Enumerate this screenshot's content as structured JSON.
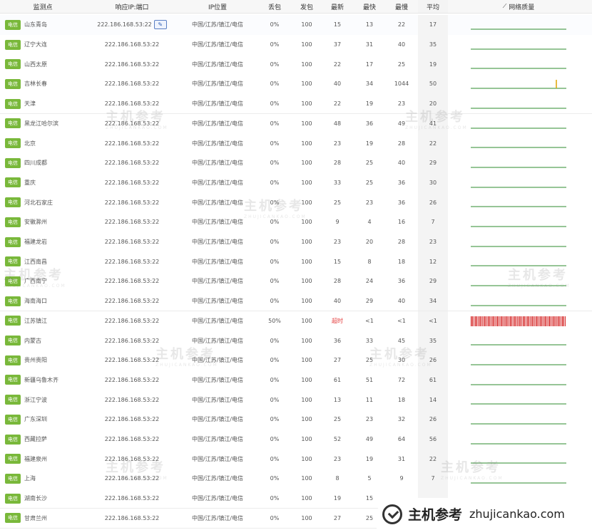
{
  "headers": {
    "node": "监测点",
    "ip_port": "响应IP:端口",
    "location": "IP位置",
    "loss": "丢包",
    "sent": "发包",
    "latest": "最新",
    "fastest": "最快",
    "slowest": "最慢",
    "average": "平均",
    "quality": "网络质量",
    "quality_icon": "signal-icon"
  },
  "badge_label": "电信",
  "edit_icon": "wrench-icon",
  "rows": [
    {
      "node": "山东青岛",
      "ip": "222.186.168.53:22",
      "loc": "中国/江苏/镇江/电信",
      "loss": "0%",
      "sent": "100",
      "latest": "15",
      "fastest": "13",
      "slowest": "22",
      "avg": "17",
      "status": "ok"
    },
    {
      "node": "辽宁大连",
      "ip": "222.186.168.53:22",
      "loc": "中国/江苏/镇江/电信",
      "loss": "0%",
      "sent": "100",
      "latest": "37",
      "fastest": "31",
      "slowest": "40",
      "avg": "35",
      "status": "ok"
    },
    {
      "node": "山西太原",
      "ip": "222.186.168.53:22",
      "loc": "中国/江苏/镇江/电信",
      "loss": "0%",
      "sent": "100",
      "latest": "22",
      "fastest": "17",
      "slowest": "25",
      "avg": "19",
      "status": "ok"
    },
    {
      "node": "吉林长春",
      "ip": "222.186.168.53:22",
      "loc": "中国/江苏/镇江/电信",
      "loss": "0%",
      "sent": "100",
      "latest": "40",
      "fastest": "34",
      "slowest": "1044",
      "avg": "50",
      "status": "spike"
    },
    {
      "node": "天津",
      "ip": "222.186.168.53:22",
      "loc": "中国/江苏/镇江/电信",
      "loss": "0%",
      "sent": "100",
      "latest": "22",
      "fastest": "19",
      "slowest": "23",
      "avg": "20",
      "status": "ok"
    },
    {
      "node": "黑龙江哈尔滨",
      "ip": "222.186.168.53:22",
      "loc": "中国/江苏/镇江/电信",
      "loss": "0%",
      "sent": "100",
      "latest": "48",
      "fastest": "36",
      "slowest": "49",
      "avg": "41",
      "status": "ok"
    },
    {
      "node": "北京",
      "ip": "222.186.168.53:22",
      "loc": "中国/江苏/镇江/电信",
      "loss": "0%",
      "sent": "100",
      "latest": "23",
      "fastest": "19",
      "slowest": "28",
      "avg": "22",
      "status": "ok"
    },
    {
      "node": "四川成都",
      "ip": "222.186.168.53:22",
      "loc": "中国/江苏/镇江/电信",
      "loss": "0%",
      "sent": "100",
      "latest": "28",
      "fastest": "25",
      "slowest": "40",
      "avg": "29",
      "status": "ok"
    },
    {
      "node": "重庆",
      "ip": "222.186.168.53:22",
      "loc": "中国/江苏/镇江/电信",
      "loss": "0%",
      "sent": "100",
      "latest": "33",
      "fastest": "25",
      "slowest": "36",
      "avg": "30",
      "status": "ok"
    },
    {
      "node": "河北石家庄",
      "ip": "222.186.168.53:22",
      "loc": "中国/江苏/镇江/电信",
      "loss": "0%",
      "sent": "100",
      "latest": "25",
      "fastest": "23",
      "slowest": "36",
      "avg": "26",
      "status": "ok"
    },
    {
      "node": "安徽滁州",
      "ip": "222.186.168.53:22",
      "loc": "中国/江苏/镇江/电信",
      "loss": "0%",
      "sent": "100",
      "latest": "9",
      "fastest": "4",
      "slowest": "16",
      "avg": "7",
      "status": "ok"
    },
    {
      "node": "福建龙岩",
      "ip": "222.186.168.53:22",
      "loc": "中国/江苏/镇江/电信",
      "loss": "0%",
      "sent": "100",
      "latest": "23",
      "fastest": "20",
      "slowest": "28",
      "avg": "23",
      "status": "ok"
    },
    {
      "node": "江西南昌",
      "ip": "222.186.168.53:22",
      "loc": "中国/江苏/镇江/电信",
      "loss": "0%",
      "sent": "100",
      "latest": "15",
      "fastest": "8",
      "slowest": "18",
      "avg": "12",
      "status": "ok"
    },
    {
      "node": "广西南宁",
      "ip": "222.186.168.53:22",
      "loc": "中国/江苏/镇江/电信",
      "loss": "0%",
      "sent": "100",
      "latest": "28",
      "fastest": "24",
      "slowest": "36",
      "avg": "29",
      "status": "ok"
    },
    {
      "node": "海南海口",
      "ip": "222.186.168.53:22",
      "loc": "中国/江苏/镇江/电信",
      "loss": "0%",
      "sent": "100",
      "latest": "40",
      "fastest": "29",
      "slowest": "40",
      "avg": "34",
      "status": "ok"
    },
    {
      "node": "江苏镇江",
      "ip": "222.186.168.53:22",
      "loc": "中国/江苏/镇江/电信",
      "loss": "50%",
      "sent": "100",
      "latest": "超时",
      "fastest": "<1",
      "slowest": "<1",
      "avg": "<1",
      "status": "loss"
    },
    {
      "node": "内蒙古",
      "ip": "222.186.168.53:22",
      "loc": "中国/江苏/镇江/电信",
      "loss": "0%",
      "sent": "100",
      "latest": "36",
      "fastest": "33",
      "slowest": "45",
      "avg": "35",
      "status": "ok"
    },
    {
      "node": "贵州贵阳",
      "ip": "222.186.168.53:22",
      "loc": "中国/江苏/镇江/电信",
      "loss": "0%",
      "sent": "100",
      "latest": "27",
      "fastest": "25",
      "slowest": "30",
      "avg": "26",
      "status": "ok"
    },
    {
      "node": "新疆乌鲁木齐",
      "ip": "222.186.168.53:22",
      "loc": "中国/江苏/镇江/电信",
      "loss": "0%",
      "sent": "100",
      "latest": "61",
      "fastest": "51",
      "slowest": "72",
      "avg": "61",
      "status": "ok"
    },
    {
      "node": "浙江宁波",
      "ip": "222.186.168.53:22",
      "loc": "中国/江苏/镇江/电信",
      "loss": "0%",
      "sent": "100",
      "latest": "13",
      "fastest": "11",
      "slowest": "18",
      "avg": "14",
      "status": "ok"
    },
    {
      "node": "广东深圳",
      "ip": "222.186.168.53:22",
      "loc": "中国/江苏/镇江/电信",
      "loss": "0%",
      "sent": "100",
      "latest": "25",
      "fastest": "23",
      "slowest": "32",
      "avg": "26",
      "status": "ok"
    },
    {
      "node": "西藏拉萨",
      "ip": "222.186.168.53:22",
      "loc": "中国/江苏/镇江/电信",
      "loss": "0%",
      "sent": "100",
      "latest": "52",
      "fastest": "49",
      "slowest": "64",
      "avg": "56",
      "status": "ok"
    },
    {
      "node": "福建泉州",
      "ip": "222.186.168.53:22",
      "loc": "中国/江苏/镇江/电信",
      "loss": "0%",
      "sent": "100",
      "latest": "23",
      "fastest": "19",
      "slowest": "31",
      "avg": "22",
      "status": "ok"
    },
    {
      "node": "上海",
      "ip": "222.186.168.53:22",
      "loc": "中国/江苏/镇江/电信",
      "loss": "0%",
      "sent": "100",
      "latest": "8",
      "fastest": "5",
      "slowest": "9",
      "avg": "7",
      "status": "ok"
    },
    {
      "node": "湖南长沙",
      "ip": "222.186.168.53:22",
      "loc": "中国/江苏/镇江/电信",
      "loss": "0%",
      "sent": "100",
      "latest": "19",
      "fastest": "15",
      "slowest": "",
      "avg": "",
      "status": "ok"
    },
    {
      "node": "甘肃兰州",
      "ip": "222.186.168.53:22",
      "loc": "中国/江苏/镇江/电信",
      "loss": "0%",
      "sent": "100",
      "latest": "27",
      "fastest": "25",
      "slowest": "",
      "avg": "",
      "status": "ok"
    }
  ],
  "watermark": {
    "cn": "主机参考",
    "en": "ZHUJICANKAO.COM"
  },
  "footer": {
    "brand": "主机参考",
    "url": "zhujicankao.com"
  },
  "colors": {
    "badge": "#79b83a",
    "ok_line": "#2e8b2e",
    "loss_bar": "#d42020",
    "spike": "#e0a400"
  }
}
